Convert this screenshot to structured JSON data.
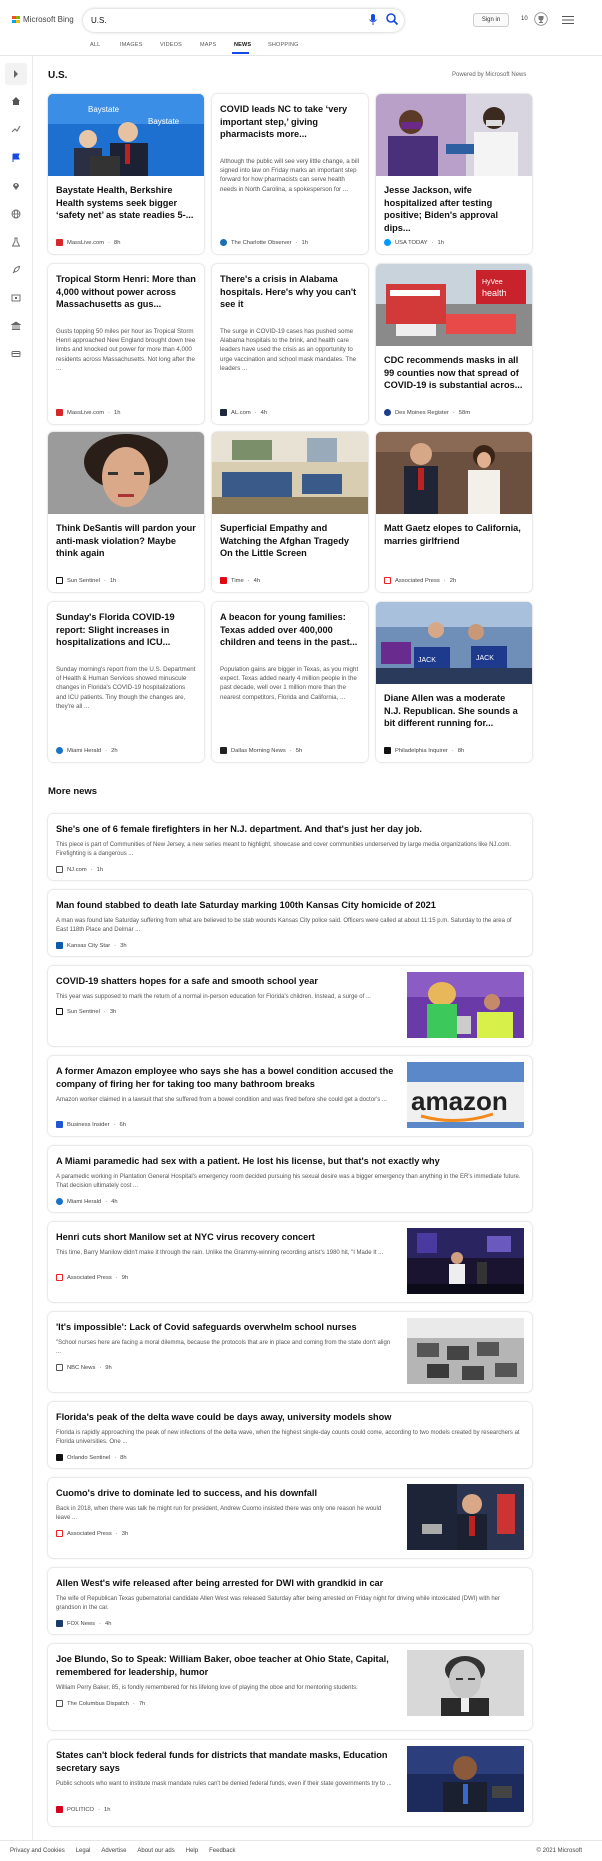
{
  "header": {
    "brand": "Microsoft Bing",
    "search_value": "U.S.",
    "sign_in": "Sign in",
    "rewards_count": "10"
  },
  "tabs": [
    "ALL",
    "IMAGES",
    "VIDEOS",
    "MAPS",
    "NEWS",
    "SHOPPING"
  ],
  "active_tab": "NEWS",
  "section": {
    "title": "U.S.",
    "powered_by": "Powered by Microsoft News"
  },
  "cards": [
    {
      "title": "Baystate Health, Berkshire Health systems seek bigger ‘safety net’ as state readies 5-...",
      "snippet": "",
      "source": "MassLive.com",
      "time": "8h"
    },
    {
      "title": "COVID leads NC to take ‘very important step,’ giving pharmacists more...",
      "snippet": "Although the public will see very little change, a bill signed into law on Friday marks an important step forward for how pharmacists can serve health needs in North Carolina, a spokesperson for ...",
      "source": "The Charlotte Observer",
      "time": "1h"
    },
    {
      "title": "Jesse Jackson, wife hospitalized after testing positive; Biden's approval dips...",
      "snippet": "",
      "source": "USA TODAY",
      "time": "1h"
    },
    {
      "title": "Tropical Storm Henri: More than 4,000 without power across Massachusetts as gus...",
      "snippet": "Gusts topping 50 miles per hour as Tropical Storm Henri approached New England brought down tree limbs and knocked out power for more than 4,000 residents across Massachusetts. Not long after the ...",
      "source": "MassLive.com",
      "time": "1h"
    },
    {
      "title": "There's a crisis in Alabama hospitals. Here's why you can't see it",
      "snippet": "The surge in COVID-19 cases has pushed some Alabama hospitals to the brink, and health care leaders have used the crisis as an opportunity to urge vaccination and school mask mandates. The leaders ...",
      "source": "AL.com",
      "time": "4h"
    },
    {
      "title": "CDC recommends masks in all 99 counties now that spread of COVID-19 is substantial acros...",
      "snippet": "",
      "source": "Des Moines Register",
      "time": "58m"
    },
    {
      "title": "Think DeSantis will pardon your anti-mask violation? Maybe think again",
      "snippet": "",
      "source": "Sun Sentinel",
      "time": "1h"
    },
    {
      "title": "Superficial Empathy and Watching the Afghan Tragedy On the Little Screen",
      "snippet": "",
      "source": "Time",
      "time": "4h"
    },
    {
      "title": "Matt Gaetz elopes to California, marries girlfriend",
      "snippet": "",
      "source": "Associated Press",
      "time": "2h"
    },
    {
      "title": "Sunday's Florida COVID-19 report: Slight increases in hospitalizations and ICU...",
      "snippet": "Sunday morning's report from the U.S. Department of Health & Human Services showed minuscule changes in Florida's COVID-19 hospitalizations and ICU patients. Tiny though the changes are, they're all ...",
      "source": "Miami Herald",
      "time": "2h"
    },
    {
      "title": "A beacon for young families: Texas added over 400,000 children and teens in the past...",
      "snippet": "Population gains are bigger in Texas, as you might expect. Texas added nearly 4 million people in the past decade, well over 1 million more than the nearest competitors, Florida and California, ...",
      "source": "Dallas Morning News",
      "time": "5h"
    },
    {
      "title": "Diane Allen was a moderate N.J. Republican. She sounds a bit different running for...",
      "snippet": "",
      "source": "Philadelphia Inquirer",
      "time": "8h"
    }
  ],
  "more_news_title": "More news",
  "more_news": [
    {
      "title": "She's one of 6 female firefighters in her N.J. department. And that's just her day job.",
      "snippet": "This piece is part of Communities of New Jersey, a new series meant to highlight, showcase and cover communities underserved by large media organizations like NJ.com. Firefighting is a dangerous ...",
      "source": "NJ.com",
      "time": "1h"
    },
    {
      "title": "Man found stabbed to death late Saturday marking 100th Kansas City homicide of 2021",
      "snippet": "A man was found late Saturday suffering from what are believed to be stab wounds Kansas City police said. Officers were called at about 11:15 p.m. Saturday to the area of East 118th Place and Delmar ...",
      "source": "Kansas City Star",
      "time": "3h"
    },
    {
      "title": "COVID-19 shatters hopes for a safe and smooth school year",
      "snippet": "This year was supposed to mark the return of a normal in-person education for Florida's children. Instead, a surge of ...",
      "source": "Sun Sentinel",
      "time": "3h"
    },
    {
      "title": "A former Amazon employee who says she has a bowel condition accused the company of firing her for taking too many bathroom breaks",
      "snippet": "Amazon worker claimed in a lawsuit that she suffered from a bowel condition and was fired before she could get a doctor's ...",
      "source": "Business Insider",
      "time": "6h"
    },
    {
      "title": "A Miami paramedic had sex with a patient. He lost his license, but that's not exactly why",
      "snippet": "A paramedic working in Plantation General Hospital's emergency room decided pursuing his sexual desire was a bigger emergency than anything in the ER's immediate future. That decision ultimately cost ...",
      "source": "Miami Herald",
      "time": "4h"
    },
    {
      "title": "Henri cuts short Manilow set at NYC virus recovery concert",
      "snippet": "This time, Barry Manilow didn't make it through the rain. Unlike the Grammy-winning recording artist's 1980 hit, \"I Made It ...",
      "source": "Associated Press",
      "time": "9h"
    },
    {
      "title": "'It's impossible': Lack of Covid safeguards overwhelm school nurses",
      "snippet": "\"School nurses here are facing a moral dilemma, because the protocols that are in place and coming from the state don't align ...",
      "source": "NBC News",
      "time": "9h"
    },
    {
      "title": "Florida's peak of the delta wave could be days away, university models show",
      "snippet": "Florida is rapidly approaching the peak of new infections of the delta wave, when the highest single-day counts could come, according to two models created by researchers at Florida universities. One ...",
      "source": "Orlando Sentinel",
      "time": "8h"
    },
    {
      "title": "Cuomo's drive to dominate led to success, and his downfall",
      "snippet": "Back in 2018, when there was talk he might run for president, Andrew Cuomo insisted there was only one reason he would leave ...",
      "source": "Associated Press",
      "time": "3h"
    },
    {
      "title": "Allen West's wife released after being arrested for DWI with grandkid in car",
      "snippet": "The wife of Republican Texas gubernatorial candidate Allen West was released Saturday after being arrested on Friday night for driving while intoxicated (DWI) with her grandson in the car.",
      "source": "FOX News",
      "time": "4h"
    },
    {
      "title": "Joe Blundo, So to Speak: William Baker, oboe teacher at Ohio State, Capital, remembered for leadership, humor",
      "snippet": "William Perry Baker, 85, is fondly remembered for his lifelong love of playing the oboe and for mentoring students.",
      "source": "The Columbus Dispatch",
      "time": "7h"
    },
    {
      "title": "States can't block federal funds for districts that mandate masks, Education secretary says",
      "snippet": "Public schools who want to institute mask mandate rules can't be denied federal funds, even if their state governments try to ...",
      "source": "POLITICO",
      "time": "1h"
    }
  ],
  "footer": {
    "links": [
      "Privacy and Cookies",
      "Legal",
      "Advertise",
      "About our ads",
      "Help",
      "Feedback"
    ],
    "copyright": "© 2021 Microsoft"
  },
  "colors": {
    "accent": "#174ae4",
    "ms_red": "#f25022",
    "ms_green": "#7fba00",
    "ms_blue": "#00a4ef",
    "ms_yellow": "#ffb900"
  }
}
